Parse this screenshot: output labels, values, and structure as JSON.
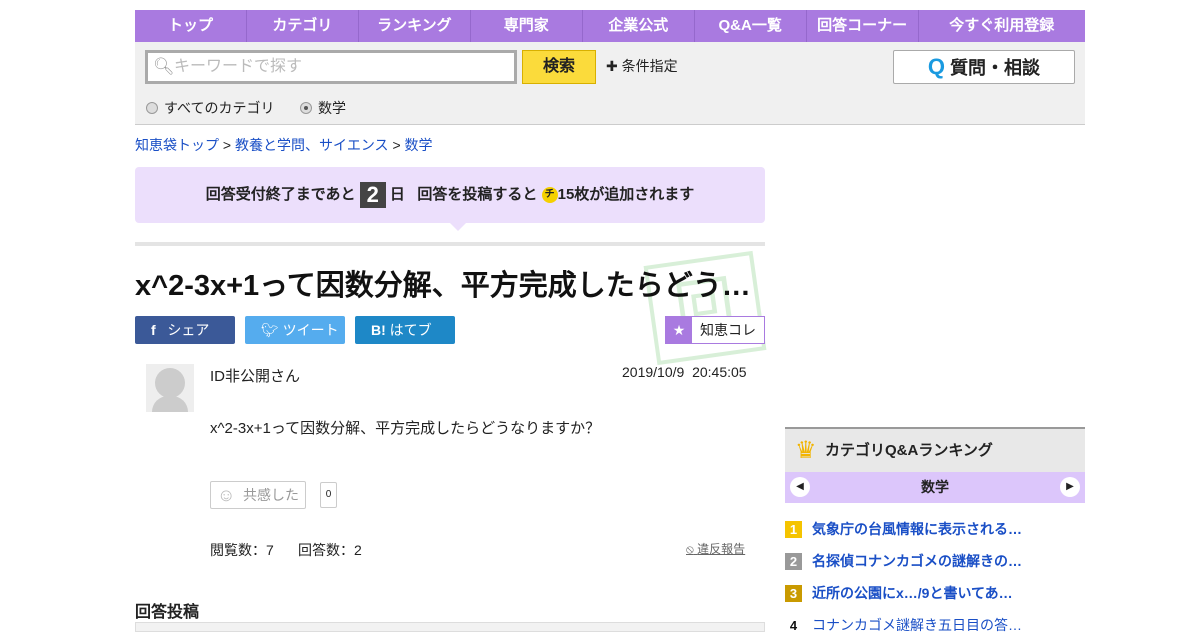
{
  "nav": [
    "トップ",
    "カテゴリ",
    "ランキング",
    "専門家",
    "企業公式",
    "Q&A一覧",
    "回答コーナー",
    "今すぐ利用登録"
  ],
  "search": {
    "placeholder": "キーワードで探す",
    "button": "検索",
    "conditions": "条件指定",
    "ask": "質問・相談",
    "ask_icon": "Q",
    "radio_all": "すべてのカテゴリ",
    "radio_cat": "数学"
  },
  "breadcrumb": [
    "知恵袋トップ",
    "教養と学問、サイエンス",
    "数学"
  ],
  "notice": {
    "pre": "回答受付終了まであと",
    "days": "2",
    "day_unit": "日",
    "post1": "回答を投稿すると",
    "coin": "チ",
    "post2": "15枚が追加されます"
  },
  "question": {
    "title": "x^2-3x+1って因数分解、平方完成したらどう…",
    "stamp": "受付中",
    "user": "ID非公開さん",
    "date": "2019/10/9",
    "time": "20:45:05",
    "body": "x^2-3x+1って因数分解、平方完成したらどうなりますか？",
    "empathy": "共感した",
    "empathy_count": "0",
    "views": "閲覧数：7",
    "answers": "回答数：2",
    "report": "違反報告"
  },
  "share": {
    "facebook": "シェア",
    "twitter": "ツイート",
    "hatena": "はてブ",
    "chiekore": "知恵コレ"
  },
  "answer_heading": "回答投稿",
  "ranking": {
    "title": "カテゴリQ&Aランキング",
    "category": "数学",
    "items": [
      {
        "n": "1",
        "text": "気象庁の台風情報に表示される…",
        "color": "#f5c400"
      },
      {
        "n": "2",
        "text": "名探偵コナンカゴメの謎解きの…",
        "color": "#999999"
      },
      {
        "n": "3",
        "text": "近所の公園にx…/9と書いてあ…",
        "color": "#c99a00"
      },
      {
        "n": "4",
        "text": "コナンカゴメ謎解き五日目の答…",
        "color": ""
      }
    ]
  }
}
